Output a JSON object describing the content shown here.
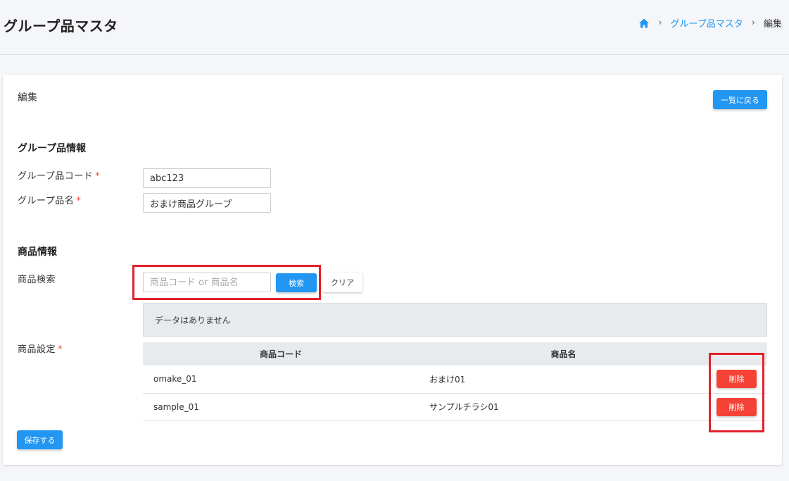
{
  "header": {
    "title": "グループ品マスタ",
    "breadcrumb": {
      "link": "グループ品マスタ",
      "current": "編集"
    }
  },
  "card": {
    "title": "編集",
    "back_label": "一覧に戻る",
    "group_section": {
      "title": "グループ品情報",
      "code_label": "グループ品コード",
      "code_value": "abc123",
      "name_label": "グループ品名",
      "name_value": "おまけ商品グループ",
      "required_mark": "*"
    },
    "product_section": {
      "title": "商品情報",
      "search_label": "商品検索",
      "search_placeholder": "商品コード or 商品名",
      "search_button": "検索",
      "clear_button": "クリア",
      "no_data": "データはありません",
      "setting_label": "商品設定",
      "table": {
        "headers": [
          "商品コード",
          "商品名"
        ],
        "rows": [
          {
            "code": "omake_01",
            "name": "おまけ01",
            "action": "削除"
          },
          {
            "code": "sample_01",
            "name": "サンプルチラシ01",
            "action": "削除"
          }
        ]
      }
    },
    "save_label": "保存する"
  },
  "colors": {
    "primary": "#2196f3",
    "danger": "#f44336",
    "highlight": "#e5202b"
  }
}
